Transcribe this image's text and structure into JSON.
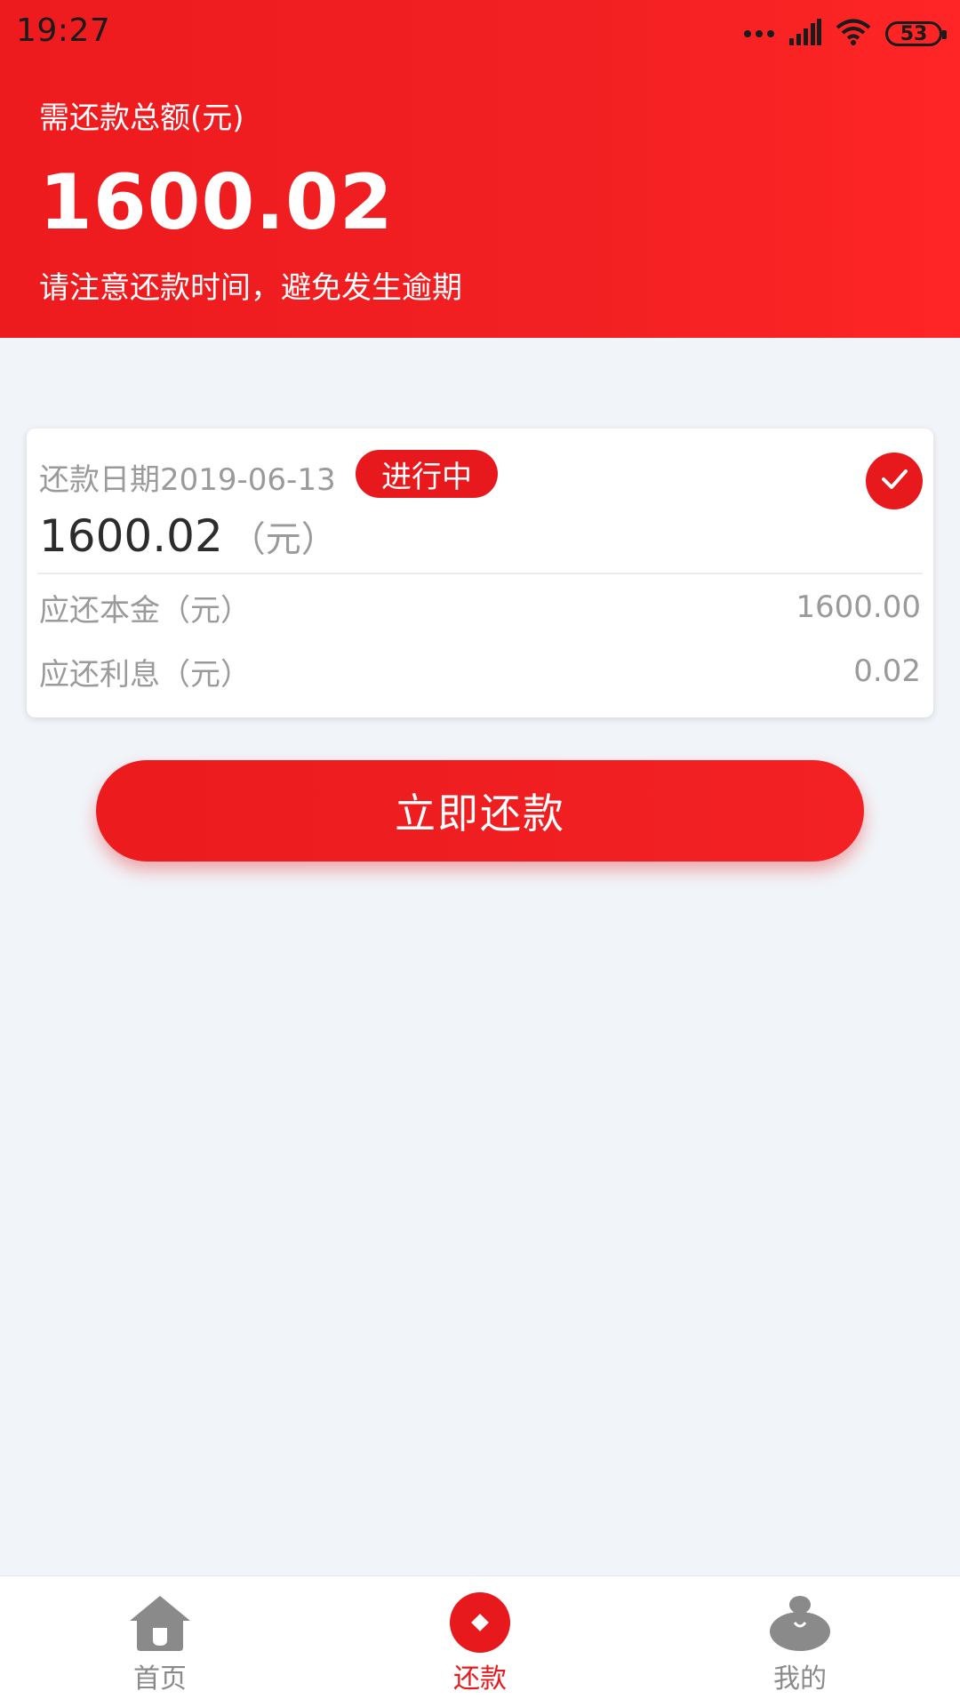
{
  "status_bar": {
    "time": "19:27",
    "battery": "53"
  },
  "header": {
    "label": "需还款总额(元)",
    "amount": "1600.02",
    "note": "请注意还款时间，避免发生逾期"
  },
  "card": {
    "date_text": "还款日期2019-06-13",
    "status": "进行中",
    "amount": "1600.02",
    "unit": "（元）",
    "rows": [
      {
        "label": "应还本金（元）",
        "value": "1600.00"
      },
      {
        "label": "应还利息（元）",
        "value": "0.02"
      }
    ]
  },
  "action": {
    "repay_label": "立即还款"
  },
  "bottom_nav": {
    "items": [
      {
        "label": "首页",
        "icon": "home-icon"
      },
      {
        "label": "还款",
        "icon": "repay-icon",
        "active": true
      },
      {
        "label": "我的",
        "icon": "mine-icon"
      }
    ]
  },
  "colors": {
    "accent": "#e8191c",
    "background": "#f1f4f8",
    "muted": "#9a9a9a"
  }
}
